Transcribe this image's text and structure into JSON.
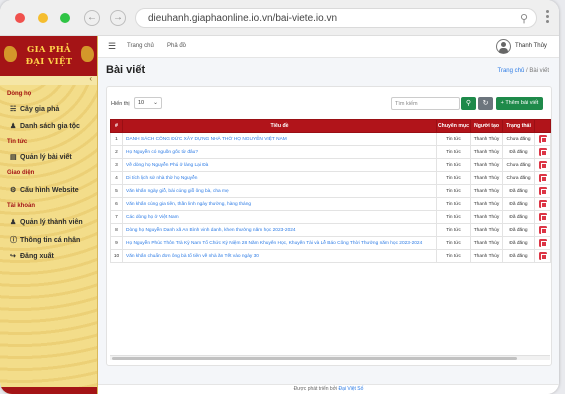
{
  "browser": {
    "url": "dieuhanh.giaphaonline.io.vn/bai-viete.io.vn"
  },
  "logo": {
    "line1": "GIA PHẢ",
    "line2": "ĐẠI VIỆT"
  },
  "sidebar": {
    "sections": [
      {
        "title": "Dòng họ",
        "items": [
          {
            "label": "Cây gia phả",
            "icon": "tree-icon"
          },
          {
            "label": "Danh sách gia tộc",
            "icon": "users-icon"
          }
        ]
      },
      {
        "title": "Tin tức",
        "items": [
          {
            "label": "Quản lý bài viết",
            "icon": "document-icon"
          }
        ]
      },
      {
        "title": "Giao diện",
        "items": [
          {
            "label": "Cấu hình Website",
            "icon": "gear-icon"
          }
        ]
      },
      {
        "title": "Tài khoản",
        "items": [
          {
            "label": "Quản lý thành viên",
            "icon": "users-icon"
          },
          {
            "label": "Thông tin cá nhân",
            "icon": "info-icon"
          },
          {
            "label": "Đăng xuất",
            "icon": "logout-icon"
          }
        ]
      }
    ]
  },
  "topnav": {
    "links": [
      "Trang chủ",
      "Phả đồ"
    ],
    "user": "Thanh Thủy"
  },
  "page": {
    "title": "Bài viết",
    "breadcrumb": {
      "home": "Trang chủ",
      "current": "Bài viết"
    }
  },
  "toolbar": {
    "show_label": "Hiển thị",
    "page_size": "10",
    "search_placeholder": "Tìm kiếm",
    "add_label": "+ Thêm bài viết"
  },
  "table": {
    "columns": [
      "#",
      "Tiêu đề",
      "Chuyên mục",
      "Người tạo",
      "Trạng thái",
      ""
    ],
    "rows": [
      {
        "num": "1",
        "title": "DANH SÁCH CÔNG ĐỨC XÂY DỰNG NHÀ THỜ HỌ NGUYỄN VIỆT NAM",
        "category": "Tin tức",
        "author": "Thanh Thủy",
        "status": "Chưa đăng"
      },
      {
        "num": "2",
        "title": "Họ Nguyễn có nguồn gốc từ đâu?",
        "category": "Tin tức",
        "author": "Thanh Thủy",
        "status": "Đã đăng"
      },
      {
        "num": "3",
        "title": "Về dòng họ Nguyễn Phú ở làng Lại Đà",
        "category": "Tin tức",
        "author": "Thanh Thủy",
        "status": "Chưa đăng"
      },
      {
        "num": "4",
        "title": "Di tích lịch sử nhà thờ họ Nguyễn",
        "category": "Tin tức",
        "author": "Thanh Thủy",
        "status": "Chưa đăng"
      },
      {
        "num": "5",
        "title": "Văn khấn ngày giỗ, bài cúng giỗ ông bà, cha mẹ",
        "category": "Tin tức",
        "author": "Thanh Thủy",
        "status": "Đã đăng"
      },
      {
        "num": "6",
        "title": "Văn khấn cúng gia tiên, thần linh ngày thường, hàng tháng",
        "category": "Tin tức",
        "author": "Thanh Thủy",
        "status": "Đã đăng"
      },
      {
        "num": "7",
        "title": "Các dòng họ ở Việt Nam",
        "category": "Tin tức",
        "author": "Thanh Thủy",
        "status": "Đã đăng"
      },
      {
        "num": "8",
        "title": "Dòng họ Nguyễn Danh xã An Bình vinh danh, khen thưởng năm học 2023-2024",
        "category": "Tin tức",
        "author": "Thanh Thủy",
        "status": "Đã đăng"
      },
      {
        "num": "9",
        "title": "Họ Nguyễn Phúc Thôn Trà Kỳ Nam Tổ Chức Kỷ Niệm 28 Năm Khuyến Học, Khuyến Tài và Lễ Báo Công Thời Thưởng năm học 2023-2024",
        "category": "Tin tức",
        "author": "Thanh Thủy",
        "status": "Đã đăng"
      },
      {
        "num": "10",
        "title": "Văn khấn chuẩn đơn ông bà tổ tiên về nhà ăn Tết vào ngày 30",
        "category": "Tin tức",
        "author": "Thanh Thủy",
        "status": "Đã đăng"
      }
    ]
  },
  "footer": {
    "text": "Được phát triển bởi",
    "brand": "Đại Việt Số"
  },
  "colors": {
    "brand_red": "#b1141a",
    "ok_green": "#1e8a4a",
    "not_red": "#d63030"
  }
}
